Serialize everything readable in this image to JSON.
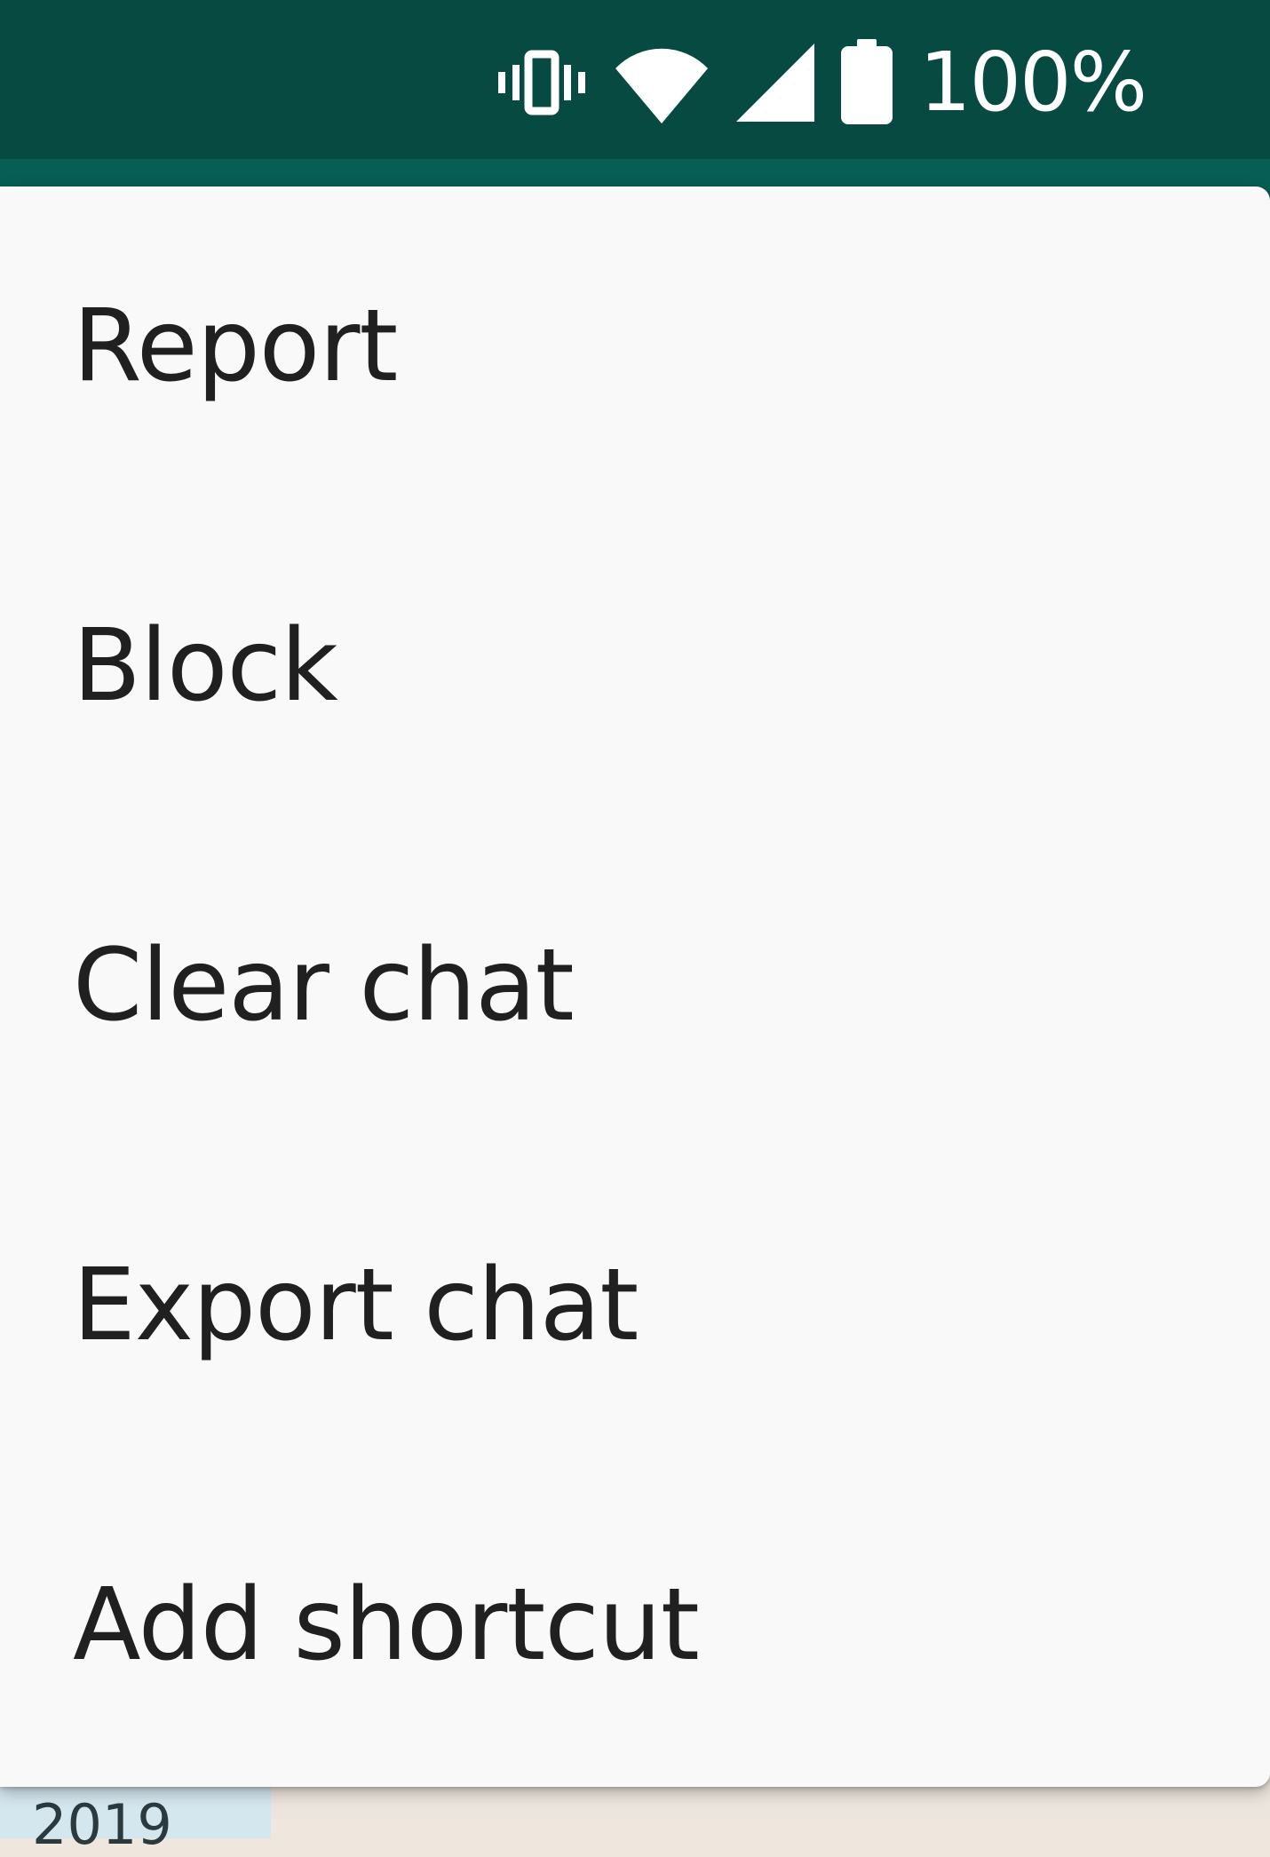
{
  "status_bar": {
    "battery_percent_label": "100%",
    "icons": [
      "vibrate-icon",
      "wifi-icon",
      "signal-icon",
      "battery-icon"
    ],
    "background_color": "#064a42"
  },
  "overflow_menu": {
    "items": [
      {
        "label": "Report"
      },
      {
        "label": "Block"
      },
      {
        "label": "Clear chat"
      },
      {
        "label": "Export chat"
      },
      {
        "label": "Add shortcut"
      }
    ]
  },
  "chat": {
    "date_chip_text": "2019"
  }
}
